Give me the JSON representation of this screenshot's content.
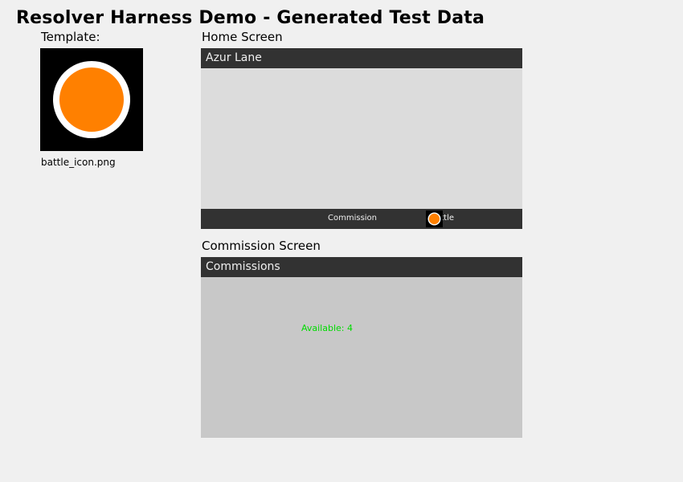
{
  "title": "Resolver Harness Demo - Generated Test Data",
  "template": {
    "label": "Template:",
    "filename": "battle_icon.png",
    "icon": "battle-icon"
  },
  "home": {
    "label": "Home Screen",
    "header": "Azur Lane",
    "bottom_bar": {
      "commission_label": "Commission",
      "battle_label": "Battle",
      "battle_icon": "battle-icon"
    }
  },
  "commission": {
    "label": "Commission Screen",
    "header": "Commissions",
    "available_text": "Available: 4"
  },
  "colors": {
    "background": "#f0f0f0",
    "header_bar": "#323232",
    "home_screen_bg": "#dcdcdc",
    "commission_screen_bg": "#c8c8c8",
    "icon_orange": "#ff8000",
    "icon_ring": "#ffffff",
    "available_green": "#00dc00"
  }
}
